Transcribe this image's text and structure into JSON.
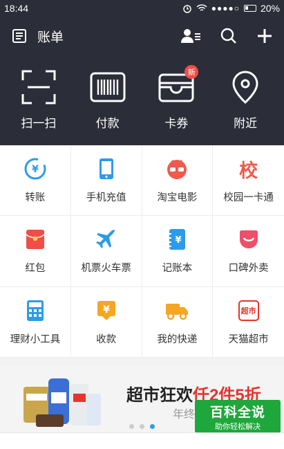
{
  "status": {
    "time": "18:44",
    "signal": "●●●●○",
    "battery": "20%"
  },
  "nav": {
    "title": "账单"
  },
  "quick": [
    {
      "label": "扫一扫",
      "icon": "scan-icon"
    },
    {
      "label": "付款",
      "icon": "barcode-icon"
    },
    {
      "label": "卡券",
      "icon": "wallet-icon",
      "badge": "新"
    },
    {
      "label": "附近",
      "icon": "location-pin-icon"
    }
  ],
  "grid": [
    {
      "label": "转账",
      "icon": "transfer-icon",
      "color": "#2d9be8"
    },
    {
      "label": "手机充值",
      "icon": "phone-icon",
      "color": "#2d9be8"
    },
    {
      "label": "淘宝电影",
      "icon": "movie-icon",
      "color": "#f05a4c"
    },
    {
      "label": "校园一卡通",
      "icon": "campus-card-icon",
      "color": "#f05a4c",
      "glyph": "校"
    },
    {
      "label": "红包",
      "icon": "red-envelope-icon",
      "color": "#f04e45"
    },
    {
      "label": "机票火车票",
      "icon": "plane-icon",
      "color": "#2d9be8"
    },
    {
      "label": "记账本",
      "icon": "notebook-icon",
      "color": "#2d9be8"
    },
    {
      "label": "口碑外卖",
      "icon": "takeout-icon",
      "color": "#f04e6a"
    },
    {
      "label": "理财小工具",
      "icon": "calculator-icon",
      "color": "#2d9be8"
    },
    {
      "label": "收款",
      "icon": "receive-money-icon",
      "color": "#f5a623"
    },
    {
      "label": "我的快递",
      "icon": "delivery-truck-icon",
      "color": "#f5a623"
    },
    {
      "label": "天猫超市",
      "icon": "tmall-market-icon",
      "color": "#e8322e",
      "glyph": "超市"
    }
  ],
  "banner": {
    "title_black": "超市狂欢",
    "title_red": "仟2件5折",
    "subtitle": "年终"
  },
  "watermark": {
    "title": "百科全说",
    "subtitle": "助你轻松解决"
  }
}
